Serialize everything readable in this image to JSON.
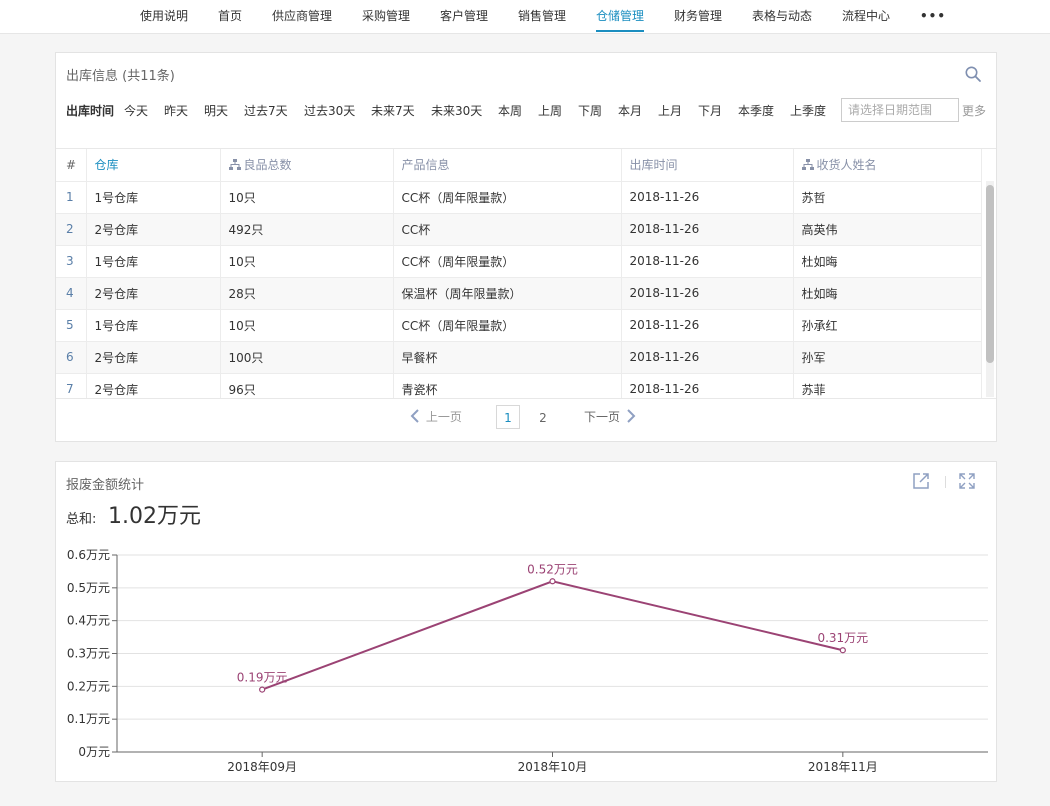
{
  "nav": {
    "items": [
      "使用说明",
      "首页",
      "供应商管理",
      "采购管理",
      "客户管理",
      "销售管理",
      "仓储管理",
      "财务管理",
      "表格与动态",
      "流程中心"
    ],
    "active_index": 6,
    "more": "•••"
  },
  "outbound": {
    "title": "出库信息 (共11条)",
    "filter_label": "出库时间",
    "filter_options": [
      "今天",
      "昨天",
      "明天",
      "过去7天",
      "过去30天",
      "未来7天",
      "未来30天",
      "本周",
      "上周",
      "下周",
      "本月",
      "上月",
      "下月",
      "本季度",
      "上季度"
    ],
    "date_placeholder": "请选择日期范围",
    "more_label": "更多",
    "columns": [
      "#",
      "仓库",
      "良品总数",
      "产品信息",
      "出库时间",
      "收货人姓名"
    ],
    "rows": [
      [
        "1",
        "1号仓库",
        "10只",
        "CC杯（周年限量款）",
        "2018-11-26",
        "苏哲"
      ],
      [
        "2",
        "2号仓库",
        "492只",
        "CC杯",
        "2018-11-26",
        "高英伟"
      ],
      [
        "3",
        "1号仓库",
        "10只",
        "CC杯（周年限量款）",
        "2018-11-26",
        "杜如晦"
      ],
      [
        "4",
        "2号仓库",
        "28只",
        "保温杯（周年限量款）",
        "2018-11-26",
        "杜如晦"
      ],
      [
        "5",
        "1号仓库",
        "10只",
        "CC杯（周年限量款）",
        "2018-11-26",
        "孙承红"
      ],
      [
        "6",
        "2号仓库",
        "100只",
        "早餐杯",
        "2018-11-26",
        "孙军"
      ],
      [
        "7",
        "2号仓库",
        "96只",
        "青瓷杯",
        "2018-11-26",
        "苏菲"
      ]
    ],
    "pager": {
      "prev": "上一页",
      "next": "下一页",
      "pages": [
        "1",
        "2"
      ],
      "current": "1"
    }
  },
  "scrap": {
    "title": "报废金额统计",
    "total_label": "总和:",
    "total_value": "1.02万元"
  },
  "chart_data": {
    "type": "line",
    "categories": [
      "2018年09月",
      "2018年10月",
      "2018年11月"
    ],
    "series": [
      {
        "values": [
          0.19,
          0.52,
          0.31
        ],
        "labels": [
          "0.19万元",
          "0.52万元",
          "0.31万元"
        ],
        "color": "#9b4374"
      }
    ],
    "y_ticks": [
      "0万元",
      "0.1万元",
      "0.2万元",
      "0.3万元",
      "0.4万元",
      "0.5万元",
      "0.6万元"
    ],
    "ylim": [
      0,
      0.6
    ],
    "grid": true
  }
}
